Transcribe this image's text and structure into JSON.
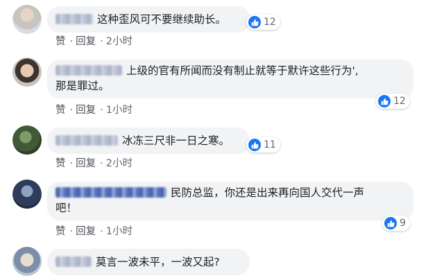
{
  "comments": [
    {
      "text": "这种歪风可不要继续助长。",
      "likes": "12",
      "time": "2小时"
    },
    {
      "text_line1": "上级的官有所闻而没有制止就等于默许这些行为',",
      "text_line2": "那是罪过。",
      "likes": "12",
      "time": "1小时"
    },
    {
      "text": "冰冻三尺非一日之寒。",
      "likes": "11",
      "time": "2小时"
    },
    {
      "text_line1": "民防总监，你还是出来再向国人交代一声",
      "text_line2": "吧！",
      "likes": "9",
      "time": "1小时"
    },
    {
      "text": "莫言一波未平，一波又起?"
    }
  ],
  "actions": {
    "like": "赞",
    "reply": "回复",
    "separator": "·"
  },
  "icons": {
    "like": "thumbs-up-icon"
  },
  "colors": {
    "like_blue": "#1877f2",
    "bubble_bg": "#f2f3f5"
  }
}
